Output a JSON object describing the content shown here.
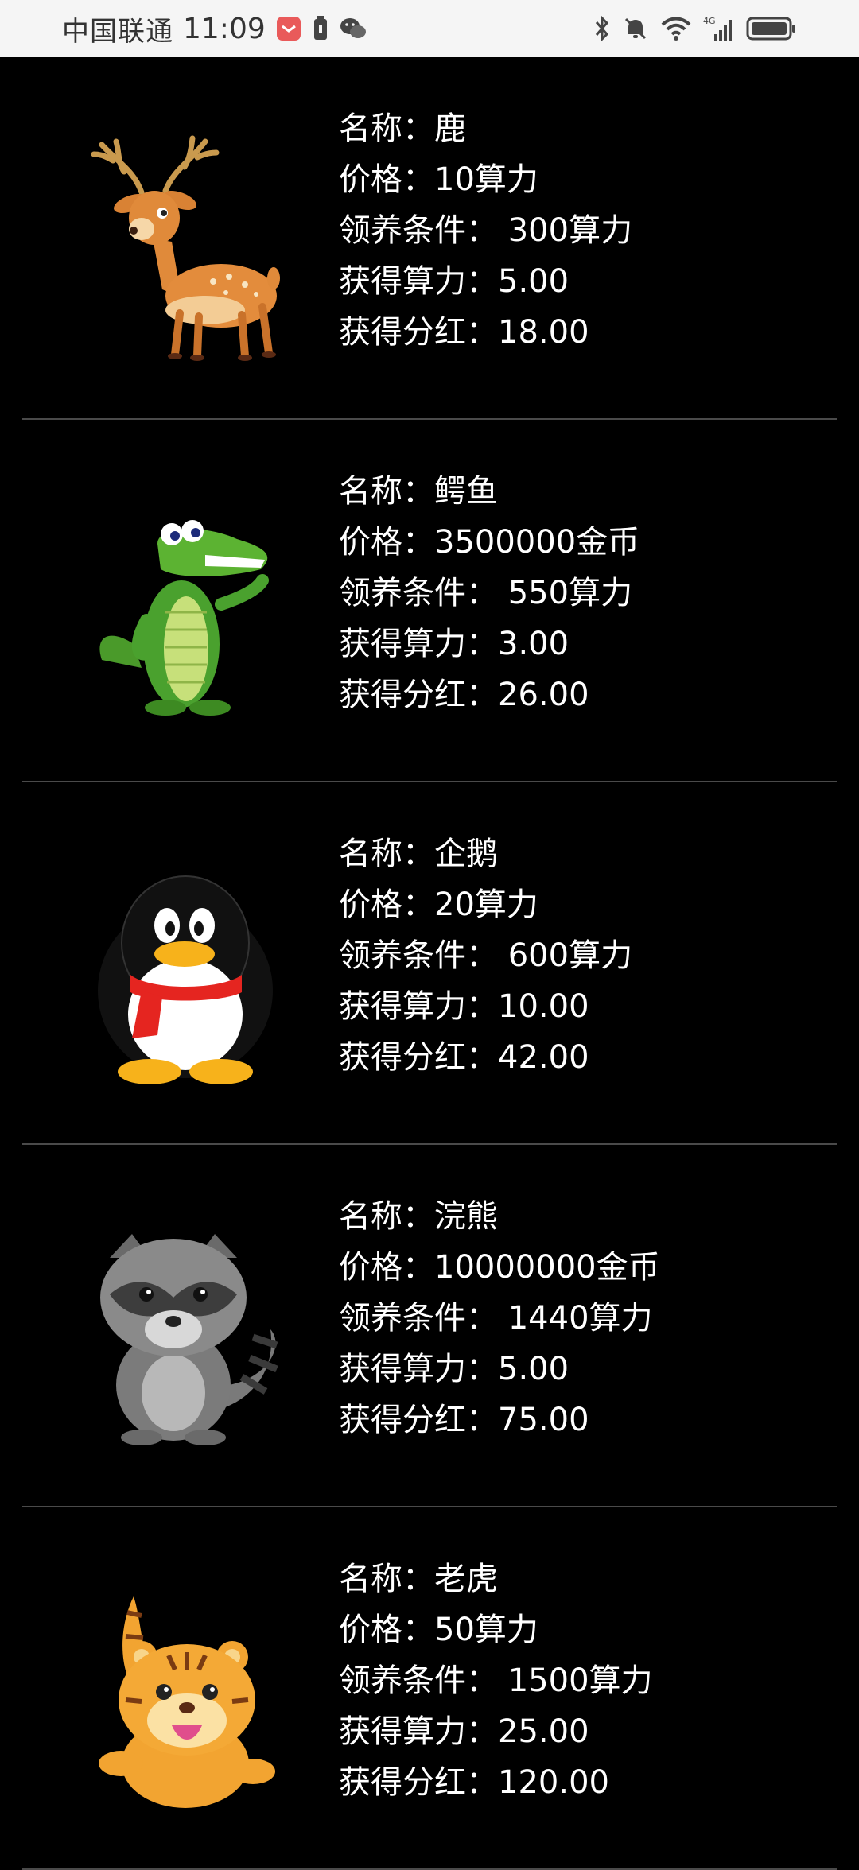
{
  "status_bar": {
    "carrier": "中国联通",
    "time": "11:09",
    "network": "4G"
  },
  "items": [
    {
      "name_label": "名称：",
      "name": "鹿",
      "price_label": "价格：",
      "price": "10算力",
      "condition_label": "领养条件：",
      "condition": "300算力",
      "hashrate_label": "获得算力：",
      "hashrate": "5.00",
      "dividend_label": "获得分红：",
      "dividend": "18.00",
      "icon": "deer"
    },
    {
      "name_label": "名称：",
      "name": "鳄鱼",
      "price_label": "价格：",
      "price": "3500000金币",
      "condition_label": "领养条件：",
      "condition": "550算力",
      "hashrate_label": "获得算力：",
      "hashrate": "3.00",
      "dividend_label": "获得分红：",
      "dividend": "26.00",
      "icon": "crocodile"
    },
    {
      "name_label": "名称：",
      "name": "企鹅",
      "price_label": "价格：",
      "price": "20算力",
      "condition_label": "领养条件：",
      "condition": "600算力",
      "hashrate_label": "获得算力：",
      "hashrate": "10.00",
      "dividend_label": "获得分红：",
      "dividend": "42.00",
      "icon": "penguin"
    },
    {
      "name_label": "名称：",
      "name": "浣熊",
      "price_label": "价格：",
      "price": "10000000金币",
      "condition_label": "领养条件：",
      "condition": "1440算力",
      "hashrate_label": "获得算力：",
      "hashrate": "5.00",
      "dividend_label": "获得分红：",
      "dividend": "75.00",
      "icon": "raccoon"
    },
    {
      "name_label": "名称：",
      "name": "老虎",
      "price_label": "价格：",
      "price": "50算力",
      "condition_label": "领养条件：",
      "condition": "1500算力",
      "hashrate_label": "获得算力：",
      "hashrate": "25.00",
      "dividend_label": "获得分红：",
      "dividend": "120.00",
      "icon": "tiger"
    }
  ]
}
